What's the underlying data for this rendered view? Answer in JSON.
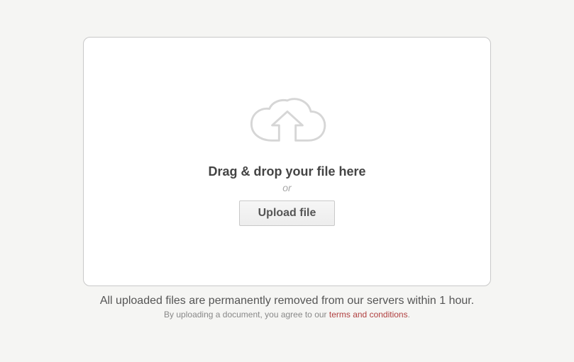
{
  "dropzone": {
    "title": "Drag & drop your file here",
    "or": "or",
    "button_label": "Upload file"
  },
  "footer": {
    "notice": "All uploaded files are permanently removed from our servers within 1 hour.",
    "agreement_prefix": "By uploading a document, you agree to our ",
    "terms_label": "terms and conditions",
    "agreement_suffix": "."
  }
}
